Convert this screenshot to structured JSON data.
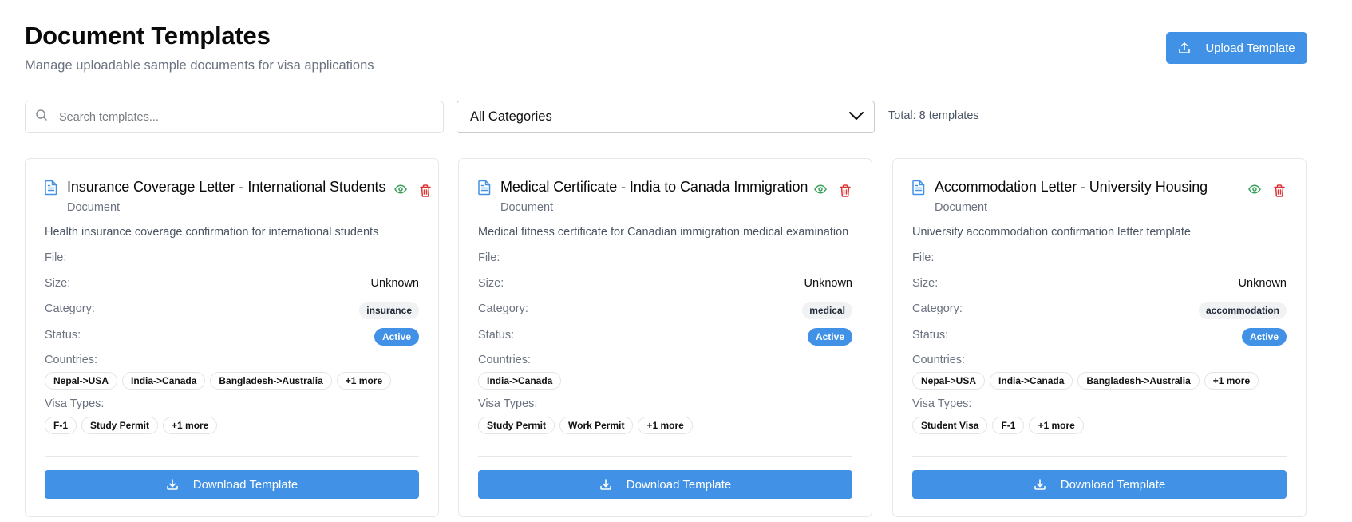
{
  "header": {
    "title": "Document Templates",
    "subtitle": "Manage uploadable sample documents for visa applications",
    "upload_label": "Upload Template"
  },
  "filters": {
    "search_placeholder": "Search templates...",
    "category_value": "All Categories",
    "total_text": "Total: 8 templates"
  },
  "labels": {
    "file": "File:",
    "size": "Size:",
    "category": "Category:",
    "status": "Status:",
    "countries": "Countries:",
    "visa_types": "Visa Types:",
    "download": "Download Template"
  },
  "colors": {
    "primary": "#4191e6",
    "view_icon": "#3aa05a",
    "delete_icon": "#e03535",
    "doc_icon": "#4191e6"
  },
  "cards": [
    {
      "title": "Insurance Coverage Letter - International Students",
      "type": "Document",
      "description": "Health insurance coverage confirmation for international students",
      "file": "",
      "size": "Unknown",
      "category": "insurance",
      "status": "Active",
      "countries": [
        "Nepal->USA",
        "India->Canada",
        "Bangladesh->Australia",
        "+1 more"
      ],
      "visa_types": [
        "F-1",
        "Study Permit",
        "+1 more"
      ]
    },
    {
      "title": "Medical Certificate - India to Canada Immigration",
      "type": "Document",
      "description": "Medical fitness certificate for Canadian immigration medical examination",
      "file": "",
      "size": "Unknown",
      "category": "medical",
      "status": "Active",
      "countries": [
        "India->Canada"
      ],
      "visa_types": [
        "Study Permit",
        "Work Permit",
        "+1 more"
      ]
    },
    {
      "title": "Accommodation Letter - University Housing",
      "type": "Document",
      "description": "University accommodation confirmation letter template",
      "file": "",
      "size": "Unknown",
      "category": "accommodation",
      "status": "Active",
      "countries": [
        "Nepal->USA",
        "India->Canada",
        "Bangladesh->Australia",
        "+1 more"
      ],
      "visa_types": [
        "Student Visa",
        "F-1",
        "+1 more"
      ]
    }
  ]
}
